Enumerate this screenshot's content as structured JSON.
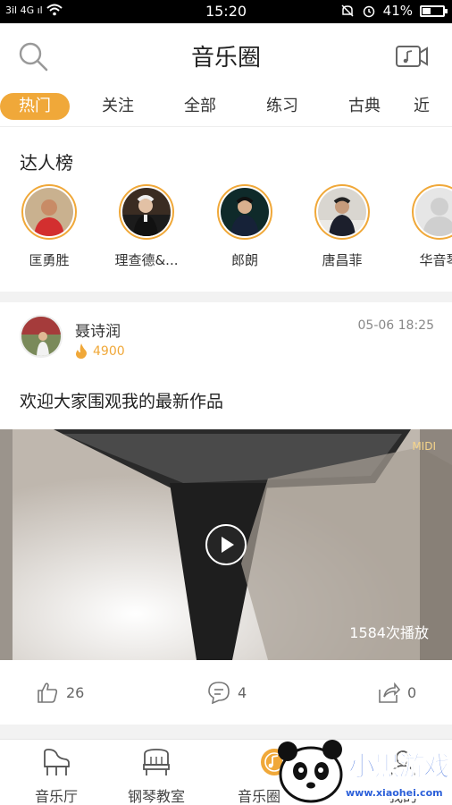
{
  "status_bar": {
    "signal": "3il 4G ıl",
    "time": "15:20",
    "battery": "41%",
    "battery_level": 0.41
  },
  "header": {
    "title": "音乐圈"
  },
  "tabs": [
    {
      "label": "热门",
      "active": true
    },
    {
      "label": "关注",
      "active": false
    },
    {
      "label": "全部",
      "active": false
    },
    {
      "label": "练习",
      "active": false
    },
    {
      "label": "古典",
      "active": false
    },
    {
      "label": "近",
      "active": false
    }
  ],
  "talent": {
    "title": "达人榜",
    "items": [
      {
        "name": "匡勇胜"
      },
      {
        "name": "理查德&..."
      },
      {
        "name": "郎朗"
      },
      {
        "name": "唐昌菲"
      },
      {
        "name": "华音琴"
      }
    ]
  },
  "post": {
    "author": "聂诗润",
    "score": "4900",
    "time": "05-06 18:25",
    "text": "欢迎大家围观我的最新作品",
    "video": {
      "tag": "MIDI",
      "play_count": "1584次播放"
    },
    "likes": "26",
    "comments": "4",
    "shares": "0"
  },
  "bottom_nav": [
    {
      "label": "音乐厅",
      "icon": "grand-piano-icon"
    },
    {
      "label": "钢琴教室",
      "icon": "upright-piano-icon"
    },
    {
      "label": "音乐圈",
      "icon": "music-circle-icon"
    },
    {
      "label": "我的",
      "icon": "profile-icon"
    }
  ],
  "watermark": {
    "text": "小黑游戏",
    "url": "www.xiaohei.com"
  },
  "colors": {
    "accent": "#f0a839",
    "text": "#222222"
  }
}
